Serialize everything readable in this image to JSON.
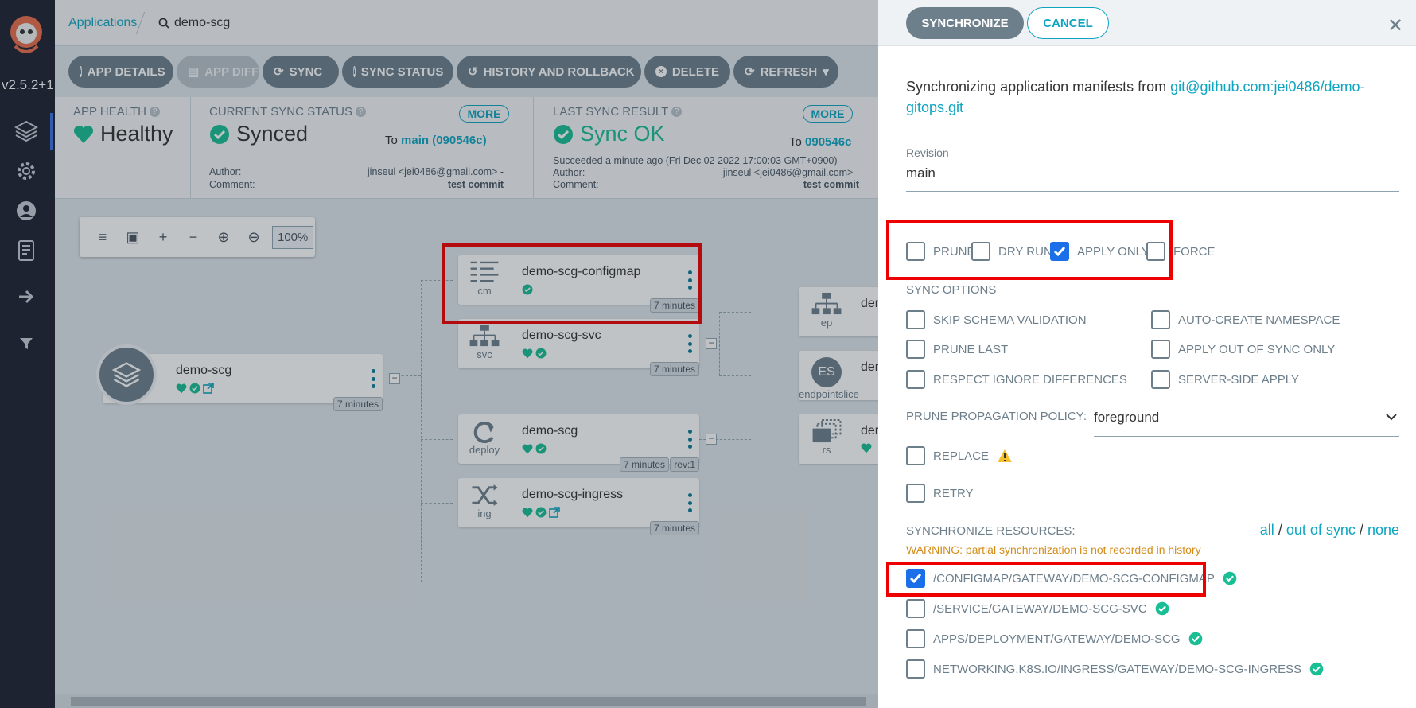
{
  "sidebar": {
    "version": "v2.5.2+1",
    "icons": [
      "layers-icon",
      "gear-icon",
      "user-icon",
      "docs-icon",
      "arrow-right-icon",
      "filter-icon"
    ]
  },
  "breadcrumb": {
    "root": "Applications",
    "current": "demo-scg"
  },
  "toolbar": {
    "app_details": "APP DETAILS",
    "app_diff": "APP DIFF",
    "sync": "SYNC",
    "sync_status": "SYNC STATUS",
    "history": "HISTORY AND ROLLBACK",
    "delete": "DELETE",
    "refresh": "REFRESH"
  },
  "status": {
    "health_label": "APP HEALTH",
    "health_value": "Healthy",
    "sync_label": "CURRENT SYNC STATUS",
    "sync_value": "Synced",
    "sync_more": "MORE",
    "sync_to_prefix": "To",
    "sync_to": "main (090546c)",
    "author_label": "Author:",
    "comment_label": "Comment:",
    "author": "jinseul <jei0486@gmail.com> -",
    "comment": "test commit",
    "last_label": "LAST SYNC RESULT",
    "last_value": "Sync OK",
    "last_more": "MORE",
    "last_to_prefix": "To",
    "last_to": "090546c",
    "last_time": "Succeeded a minute ago (Fri Dec 02 2022 17:00:03 GMT+0900)"
  },
  "zoom": {
    "level": "100%"
  },
  "nodes": {
    "root": {
      "name": "demo-scg",
      "age": "7 minutes"
    },
    "configmap": {
      "name": "demo-scg-configmap",
      "kind": "cm",
      "age": "7 minutes"
    },
    "svc": {
      "name": "demo-scg-svc",
      "kind": "svc",
      "age": "7 minutes"
    },
    "deploy": {
      "name": "demo-scg",
      "kind": "deploy",
      "age": "7 minutes",
      "rev": "rev:1"
    },
    "ingress": {
      "name": "demo-scg-ingress",
      "kind": "ing",
      "age": "7 minutes"
    },
    "ep": {
      "name": "der",
      "kind": "ep"
    },
    "es": {
      "name": "der",
      "kind": "endpointslice",
      "badge": "ES"
    },
    "rs": {
      "name": "der",
      "kind": "rs"
    }
  },
  "panel": {
    "synchronize": "SYNCHRONIZE",
    "cancel": "CANCEL",
    "intro": "Synchronizing application manifests from ",
    "repo": "git@github.com:jei0486/demo-gitops.git",
    "revision_label": "Revision",
    "revision": "main",
    "opts": {
      "prune": "PRUNE",
      "dry_run": "DRY RUN",
      "apply_only": "APPLY ONLY",
      "force": "FORCE"
    },
    "sync_options_label": "SYNC OPTIONS",
    "sync_opts": {
      "skip_schema": "SKIP SCHEMA VALIDATION",
      "auto_ns": "AUTO-CREATE NAMESPACE",
      "prune_last": "PRUNE LAST",
      "apply_out": "APPLY OUT OF SYNC ONLY",
      "respect_ignore": "RESPECT IGNORE DIFFERENCES",
      "server_side": "SERVER-SIDE APPLY"
    },
    "propagation_label": "PRUNE PROPAGATION POLICY:",
    "propagation": "foreground",
    "replace": "REPLACE",
    "retry": "RETRY",
    "resources_label": "SYNCHRONIZE RESOURCES:",
    "all": "all",
    "out_of_sync": "out of sync",
    "none": "none",
    "sep": "/",
    "warning": "WARNING: partial synchronization is not recorded in history",
    "resources": [
      "/CONFIGMAP/GATEWAY/DEMO-SCG-CONFIGMAP",
      "/SERVICE/GATEWAY/DEMO-SCG-SVC",
      "APPS/DEPLOYMENT/GATEWAY/DEMO-SCG",
      "NETWORKING.K8S.IO/INGRESS/GATEWAY/DEMO-SCG-INGRESS"
    ]
  },
  "colors": {
    "accent": "#0fa5c1",
    "healthy": "#18be94",
    "checked": "#1b6fe8",
    "highlight": "#e00000"
  }
}
